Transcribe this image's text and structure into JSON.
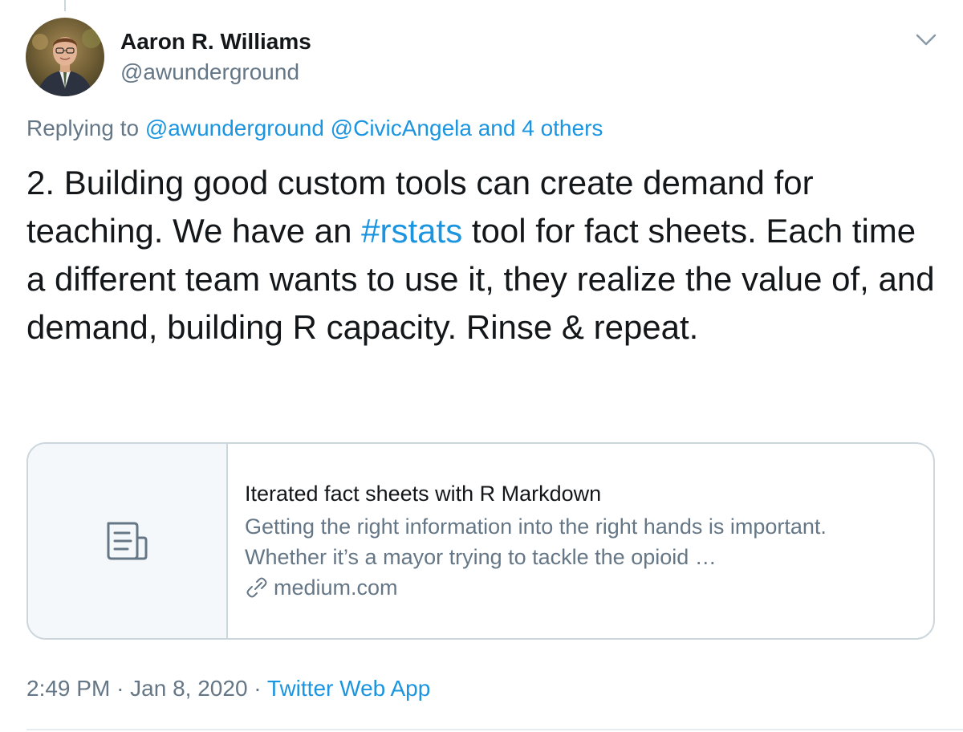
{
  "tweet": {
    "author": {
      "display_name": "Aaron R. Williams",
      "handle": "@awunderground",
      "avatar_icon": "avatar-photo"
    },
    "reply": {
      "prefix": "Replying to",
      "mentions": [
        "@awunderground",
        "@CivicAngela"
      ],
      "others": "and 4 others"
    },
    "text": {
      "part1": "2. Building good custom tools can create demand for teaching. We have an ",
      "hashtag": "#rstats",
      "part2": " tool for fact sheets. Each time a different team wants to use it, they realize the value of, and demand, building R capacity. Rinse & repeat."
    },
    "card": {
      "icon": "document-icon",
      "title": "Iterated fact sheets with R Markdown",
      "description": "Getting the right information into the right hands is important. Whether it’s a mayor trying to tackle the opioid …",
      "domain_icon": "link-icon",
      "domain": "medium.com"
    },
    "meta": {
      "time": "2:49 PM",
      "separator": "·",
      "date": "Jan 8, 2020",
      "source": "Twitter Web App"
    },
    "colors": {
      "link": "#1b95e0",
      "secondary": "#657786",
      "border": "#ccd6dd"
    }
  }
}
